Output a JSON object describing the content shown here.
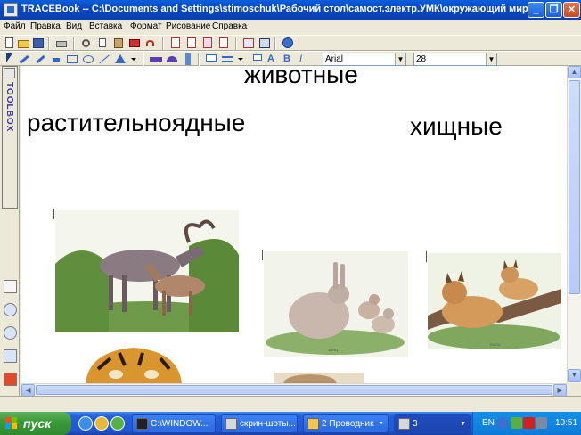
{
  "window": {
    "title": "TRACEBook -- C:\\Documents and Settings\\stimoschuk\\Рабочий стол\\самост.электр.УМК\\окружающий мир\\рас...",
    "minimize_label": "_",
    "maximize_label": "❐",
    "close_label": "✕"
  },
  "menu": [
    "Файл",
    "Правка",
    "Вид",
    "Вставка",
    "Формат",
    "Рисование",
    "Справка"
  ],
  "format_toolbar": {
    "font": "Arial",
    "size": "28",
    "bold_label": "B",
    "italic_label": "I",
    "text_label": "A"
  },
  "toolbox": {
    "label": "TOOLBOX"
  },
  "page": {
    "heading": "животные",
    "left_group": "растительноядные",
    "right_group": "хищные"
  },
  "pictures": {
    "moose": {
      "caption": ""
    },
    "hare": {
      "caption": "ЗАЯЦ"
    },
    "lynx": {
      "caption": "РЫСЬ"
    }
  },
  "taskbar": {
    "start_label": "пуск",
    "tasks": [
      {
        "label": "C:\\WINDOW...",
        "active": false
      },
      {
        "label": "скрин-шоты...",
        "active": false
      },
      {
        "label": "2 Проводник",
        "active": false
      },
      {
        "label": "3",
        "active": true
      }
    ],
    "lang": "EN",
    "clock": "10:51"
  },
  "colors": {
    "titlebar": "#0a5fd8",
    "canvas": "#ffffff",
    "start": "#3c9a3a",
    "taskbar": "#245edb"
  }
}
